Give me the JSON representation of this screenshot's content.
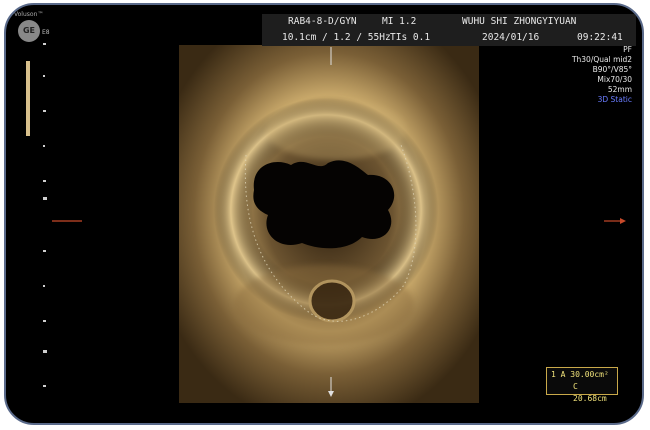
{
  "header": {
    "probe_preset": "RAB4-8-D/GYN",
    "mi": "MI  1.2",
    "institution": "WUHU SHI ZHONGYIYUAN",
    "depth_freq": "10.1cm / 1.2 / 55Hz",
    "tis": "TIs  0.1",
    "date": "2024/01/16",
    "time": "09:22:41"
  },
  "logo": {
    "text": "GE",
    "top_label": "Voluson™",
    "side_label": "E8"
  },
  "params": [
    "PF",
    "Th30/Qual mid2",
    "B90°/V85°",
    "Mix70/30",
    "52mm",
    "3D Static"
  ],
  "measurement": {
    "line1": "1  A  30.00cm²",
    "line2": "C  20.68cm"
  },
  "colors": {
    "tissue": "#c8a86a",
    "accent_blue": "#6a7cff",
    "marker": "#c84a2a"
  }
}
